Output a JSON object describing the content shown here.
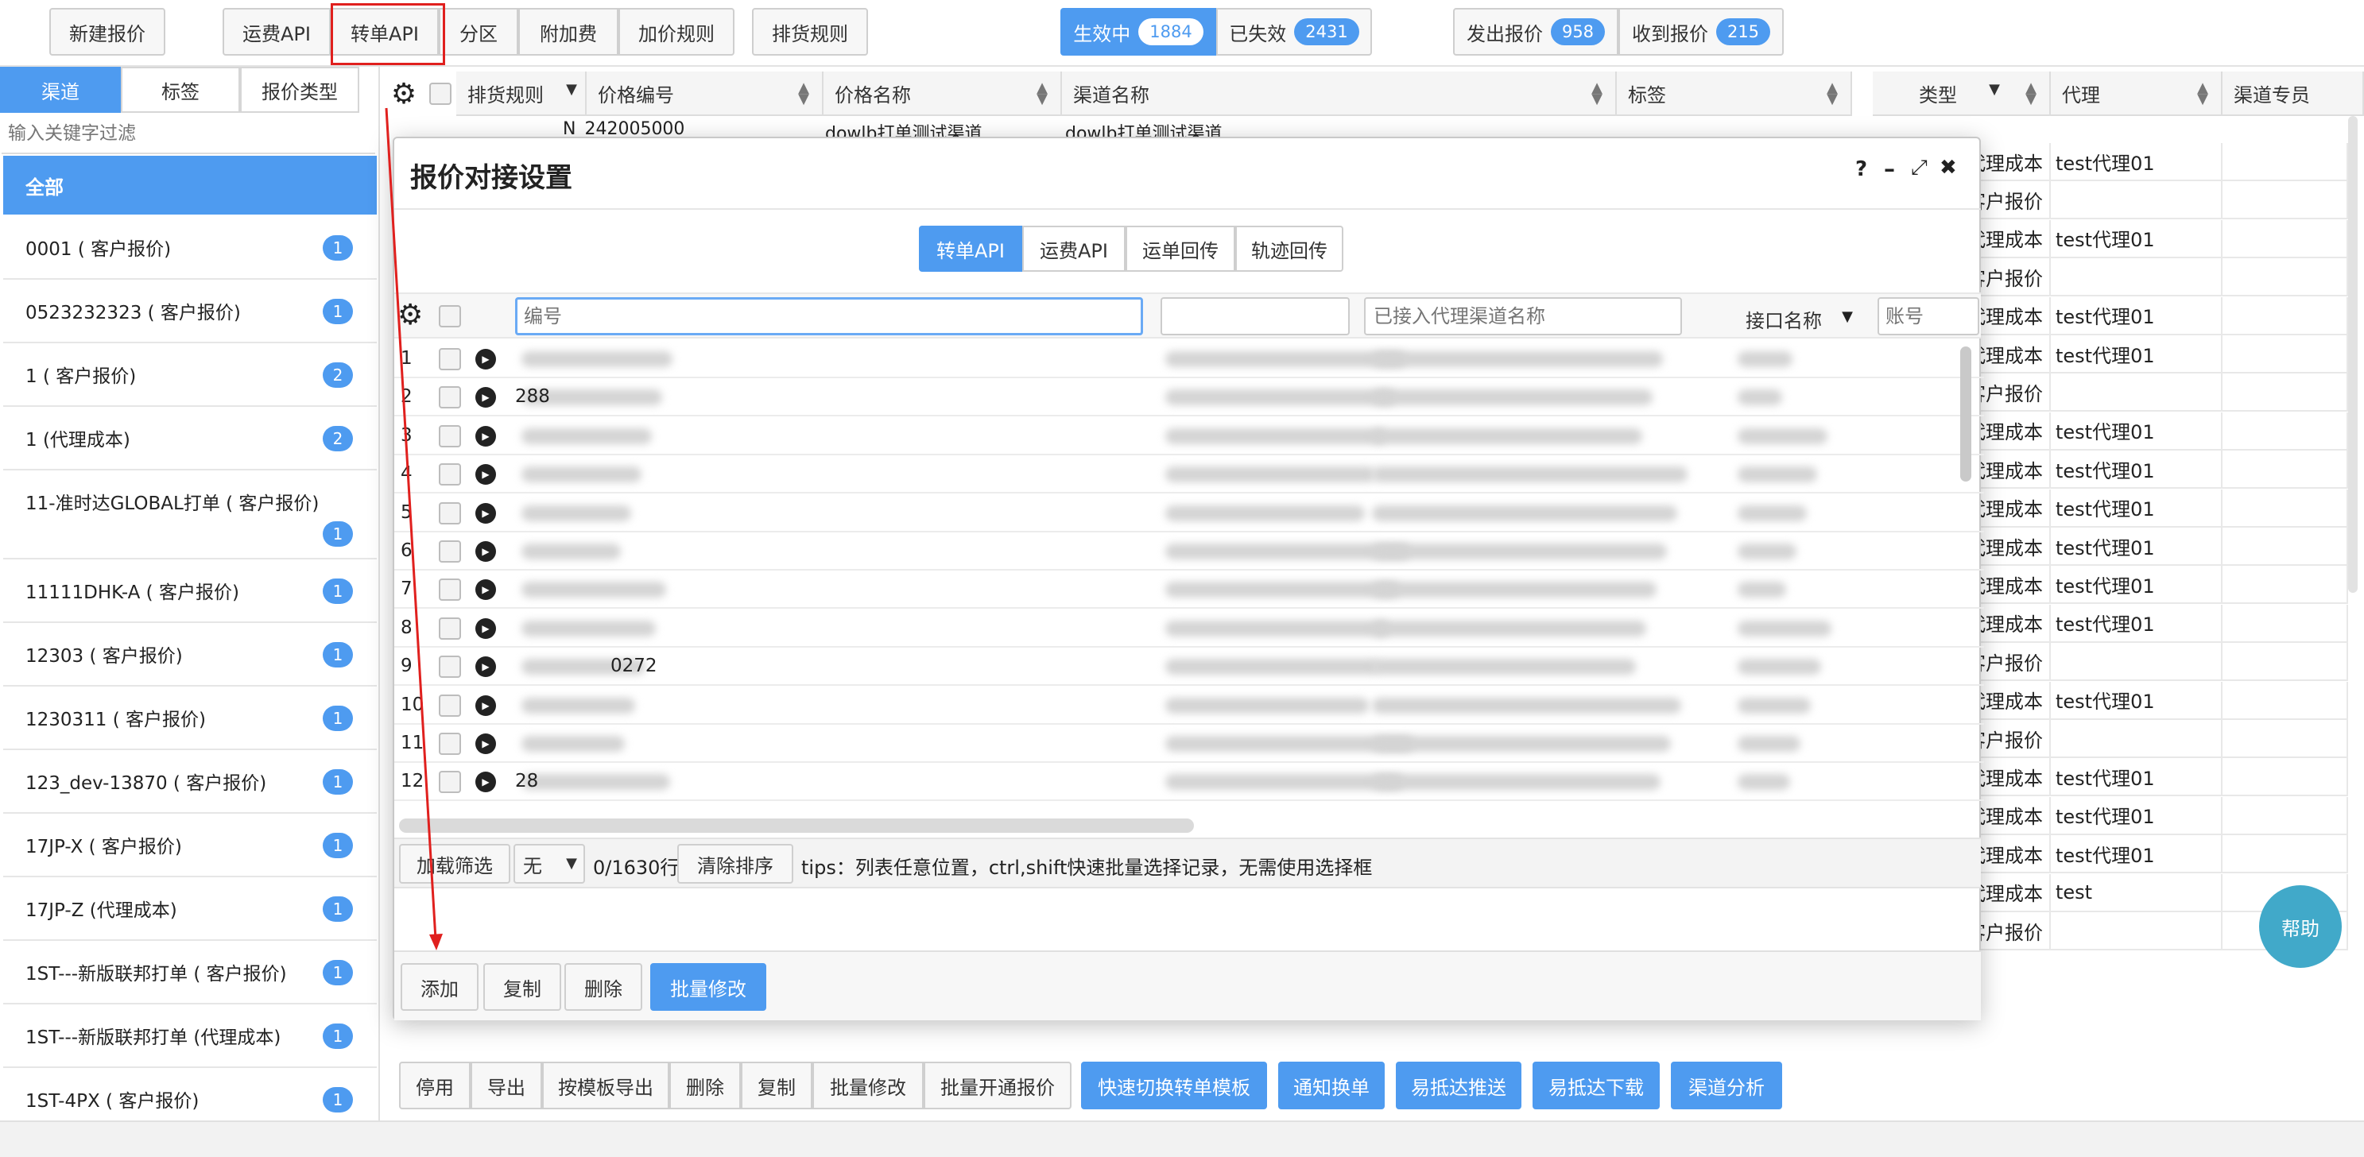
{
  "toolbar": {
    "new_quote": "新建报价",
    "freight_api": "运费API",
    "transfer_api": "转单API",
    "zone": "分区",
    "surcharge": "附加费",
    "markup_rules": "加价规则",
    "sort_rules": "排货规则",
    "active_label": "生效中",
    "active_count": "1884",
    "expired_label": "已失效",
    "expired_count": "2431",
    "sent_label": "发出报价",
    "sent_count": "958",
    "received_label": "收到报价",
    "received_count": "215"
  },
  "sidebar": {
    "tabs": [
      "渠道",
      "标签",
      "报价类型"
    ],
    "filter_placeholder": "输入关键字过滤",
    "all_label": "全部",
    "items": [
      {
        "label": "0001 ( 客户报价)",
        "count": "1"
      },
      {
        "label": "0523232323 ( 客户报价)",
        "count": "1"
      },
      {
        "label": "1 ( 客户报价)",
        "count": "2"
      },
      {
        "label": "1 (代理成本)",
        "count": "2"
      },
      {
        "label": "11-准时达GLOBAL打单 ( 客户报价)",
        "count": "1"
      },
      {
        "label": "11111DHK-A ( 客户报价)",
        "count": "1"
      },
      {
        "label": "12303 ( 客户报价)",
        "count": "1"
      },
      {
        "label": "1230311 ( 客户报价)",
        "count": "1"
      },
      {
        "label": "123_dev-13870 ( 客户报价)",
        "count": "1"
      },
      {
        "label": "17JP-X ( 客户报价)",
        "count": "1"
      },
      {
        "label": "17JP-Z (代理成本)",
        "count": "1"
      },
      {
        "label": "1ST---新版联邦打单 ( 客户报价)",
        "count": "1"
      },
      {
        "label": "1ST---新版联邦打单 (代理成本)",
        "count": "1"
      },
      {
        "label": "1ST-4PX ( 客户报价)",
        "count": "1"
      }
    ]
  },
  "grid": {
    "columns": [
      "排货规则",
      "价格编号",
      "价格名称",
      "渠道名称",
      "标签",
      "类型",
      "代理",
      "渠道专员"
    ],
    "first_row_partial": {
      "code": "N_242005000",
      "name": "dowlb打单测试渠道",
      "channel": "dowlb打单测试渠道"
    },
    "rows": [
      {
        "type": "代理成本",
        "agent": "test代理01"
      },
      {
        "type": "客户报价",
        "agent": ""
      },
      {
        "type": "代理成本",
        "agent": "test代理01"
      },
      {
        "type": "客户报价",
        "agent": ""
      },
      {
        "type": "代理成本",
        "agent": "test代理01"
      },
      {
        "type": "代理成本",
        "agent": "test代理01"
      },
      {
        "type": "客户报价",
        "agent": ""
      },
      {
        "type": "代理成本",
        "agent": "test代理01"
      },
      {
        "type": "代理成本",
        "agent": "test代理01"
      },
      {
        "type": "代理成本",
        "agent": "test代理01"
      },
      {
        "type": "代理成本",
        "agent": "test代理01"
      },
      {
        "type": "代理成本",
        "agent": "test代理01"
      },
      {
        "type": "代理成本",
        "agent": "test代理01"
      },
      {
        "type": "客户报价",
        "agent": ""
      },
      {
        "type": "代理成本",
        "agent": "test代理01"
      },
      {
        "type": "客户报价",
        "agent": ""
      },
      {
        "type": "代理成本",
        "agent": "test代理01"
      },
      {
        "type": "代理成本",
        "agent": "test代理01"
      },
      {
        "type": "代理成本",
        "agent": "test代理01"
      },
      {
        "type": "代理成本",
        "agent": "test"
      },
      {
        "type": "客户报价",
        "agent": ""
      }
    ]
  },
  "dialog": {
    "title": "报价对接设置",
    "ctrl_help": "?",
    "ctrl_min": "–",
    "ctrl_max": "⤢",
    "ctrl_close": "✖",
    "tabs": [
      "转单API",
      "运费API",
      "运单回传",
      "轨迹回传"
    ],
    "filter_code_placeholder": "编号",
    "filter_channel_placeholder": "已接入代理渠道名称",
    "col_interface": "接口名称",
    "filter_account_placeholder": "账号",
    "row_numbers": [
      "1",
      "2",
      "3",
      "4",
      "5",
      "6",
      "7",
      "8",
      "9",
      "10",
      "11",
      "12"
    ],
    "visible_fragments": {
      "r2": "288",
      "r9": "0272",
      "r12": "28"
    },
    "footer": {
      "load_filter": "加载筛选",
      "none": "无",
      "rows": "0/1630行",
      "clear_sort": "清除排序",
      "tips": "tips：列表任意位置，ctrl,shift快速批量选择记录，无需使用选择框"
    },
    "actions": {
      "add": "添加",
      "copy": "复制",
      "delete": "删除",
      "batch_edit": "批量修改"
    }
  },
  "bottom": {
    "buttons": [
      "停用",
      "导出",
      "按模板导出",
      "删除",
      "复制",
      "批量修改",
      "批量开通报价"
    ],
    "blue_buttons": [
      "快速切换转单模板",
      "通知换单",
      "易抵达推送",
      "易抵达下载",
      "渠道分析"
    ]
  },
  "help_button": "帮助",
  "colors": {
    "accent": "#4e9bf0",
    "annotation": "#e0201e",
    "help": "#41a9c9"
  }
}
